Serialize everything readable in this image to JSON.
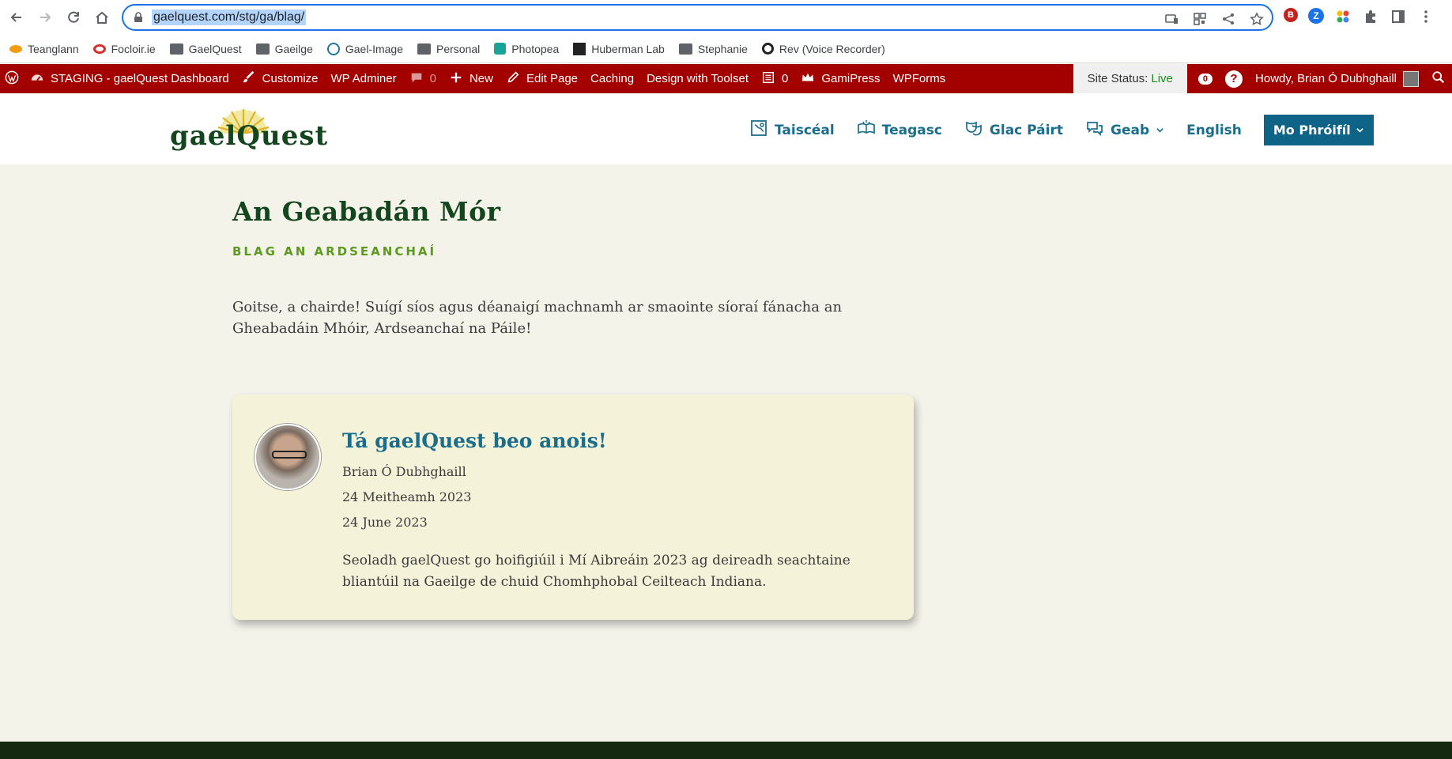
{
  "browser": {
    "url": "gaelquest.com/stg/ga/blag/",
    "bookmarks": [
      {
        "label": "Teanglann",
        "icon": "teanglann-icon"
      },
      {
        "label": "Focloir.ie",
        "icon": "focloir-icon"
      },
      {
        "label": "GaelQuest",
        "icon": "folder-icon"
      },
      {
        "label": "Gaeilge",
        "icon": "folder-icon"
      },
      {
        "label": "Gael-Image",
        "icon": "wordpress-icon"
      },
      {
        "label": "Personal",
        "icon": "folder-icon"
      },
      {
        "label": "Photopea",
        "icon": "photopea-icon"
      },
      {
        "label": "Huberman Lab",
        "icon": "huberman-icon"
      },
      {
        "label": "Stephanie",
        "icon": "folder-icon"
      },
      {
        "label": "Rev (Voice Recorder)",
        "icon": "rev-icon"
      }
    ]
  },
  "wpbar": {
    "dashboard": "STAGING - gaelQuest Dashboard",
    "customize": "Customize",
    "wp_adminer": "WP Adminer",
    "comments": "0",
    "new": "New",
    "edit_page": "Edit Page",
    "caching": "Caching",
    "toolset": "Design with Toolset",
    "forms_count": "0",
    "gamipress": "GamiPress",
    "wpforms": "WPForms",
    "site_status_label": "Site Status:",
    "site_status_value": "Live",
    "notif_count": "0",
    "help": "?",
    "howdy": "Howdy, Brian Ó Dubhghaill"
  },
  "site": {
    "logo_text": "gaelQuest",
    "nav": [
      {
        "label": "Taiscéal",
        "icon": "map-icon"
      },
      {
        "label": "Teagasc",
        "icon": "book-icon"
      },
      {
        "label": "Glac Páirt",
        "icon": "masks-icon"
      },
      {
        "label": "Geab",
        "icon": "chat-icon"
      },
      {
        "label": "English"
      }
    ],
    "profile_button": "Mo Phróifíl"
  },
  "page": {
    "title": "An Geabadán Mór",
    "subtitle": "BLAG AN ARDSEANCHAÍ",
    "intro": "Goitse, a chairde! Suígí síos agus déanaigí machnamh ar smaointe síoraí fánacha an Gheabadáin Mhóir, Ardseanchaí na Páile!"
  },
  "post": {
    "title": "Tá gaelQuest beo anois!",
    "author": "Brian Ó Dubhghaill",
    "date_ga": "24 Meitheamh 2023",
    "date_en": "24 June 2023",
    "excerpt": "Seoladh gaelQuest go hoifigiúil i Mí Aibreáin 2023 ag deireadh seachtaine bliantúil na Gaeilge de chuid Chomhphobal Ceilteach Indiana."
  },
  "colors": {
    "wpbar": "#a30000",
    "brand_green": "#14461e",
    "link_blue": "#1b6d8c",
    "profile_button": "#0d6487",
    "card_bg": "#f4f2d8"
  }
}
